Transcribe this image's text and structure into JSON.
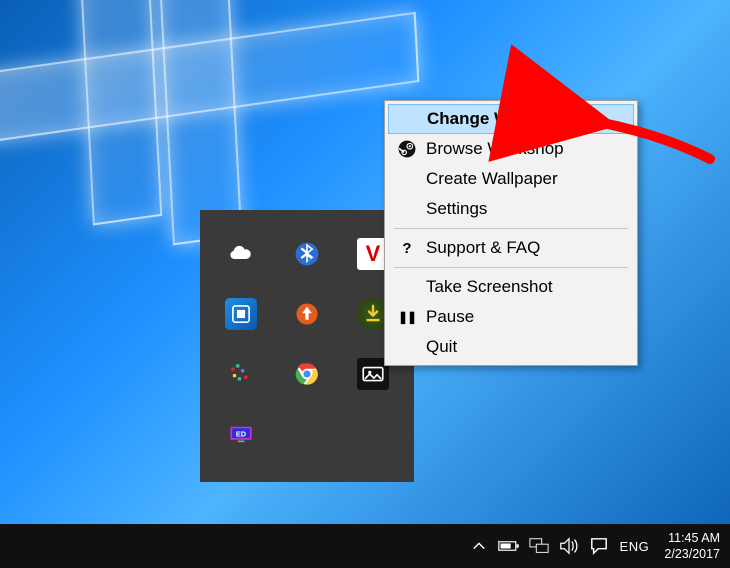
{
  "context_menu": {
    "items": [
      {
        "icon": "",
        "label": "Change Wallpaper",
        "highlight": true,
        "bold": true
      },
      {
        "icon": "steam",
        "label": "Browse Workshop"
      },
      {
        "icon": "",
        "label": "Create Wallpaper"
      },
      {
        "icon": "",
        "label": "Settings"
      }
    ],
    "items2": [
      {
        "icon": "?",
        "label": "Support & FAQ"
      }
    ],
    "items3": [
      {
        "icon": "",
        "label": "Take Screenshot"
      },
      {
        "icon": "❚❚",
        "label": "Pause"
      },
      {
        "icon": "",
        "label": "Quit"
      }
    ]
  },
  "tray": {
    "items": [
      "onedrive",
      "bluetooth",
      "antivirus",
      "intel-graphics",
      "updater",
      "downloader",
      "pixels",
      "chrome",
      "wallpaper-engine",
      "monitor"
    ]
  },
  "taskbar": {
    "chevron": "⌃",
    "battery": "battery",
    "network": "network",
    "volume": "volume",
    "action": "action-center",
    "ime": "ENG",
    "time": "11:45 AM",
    "date": "2/23/2017"
  }
}
